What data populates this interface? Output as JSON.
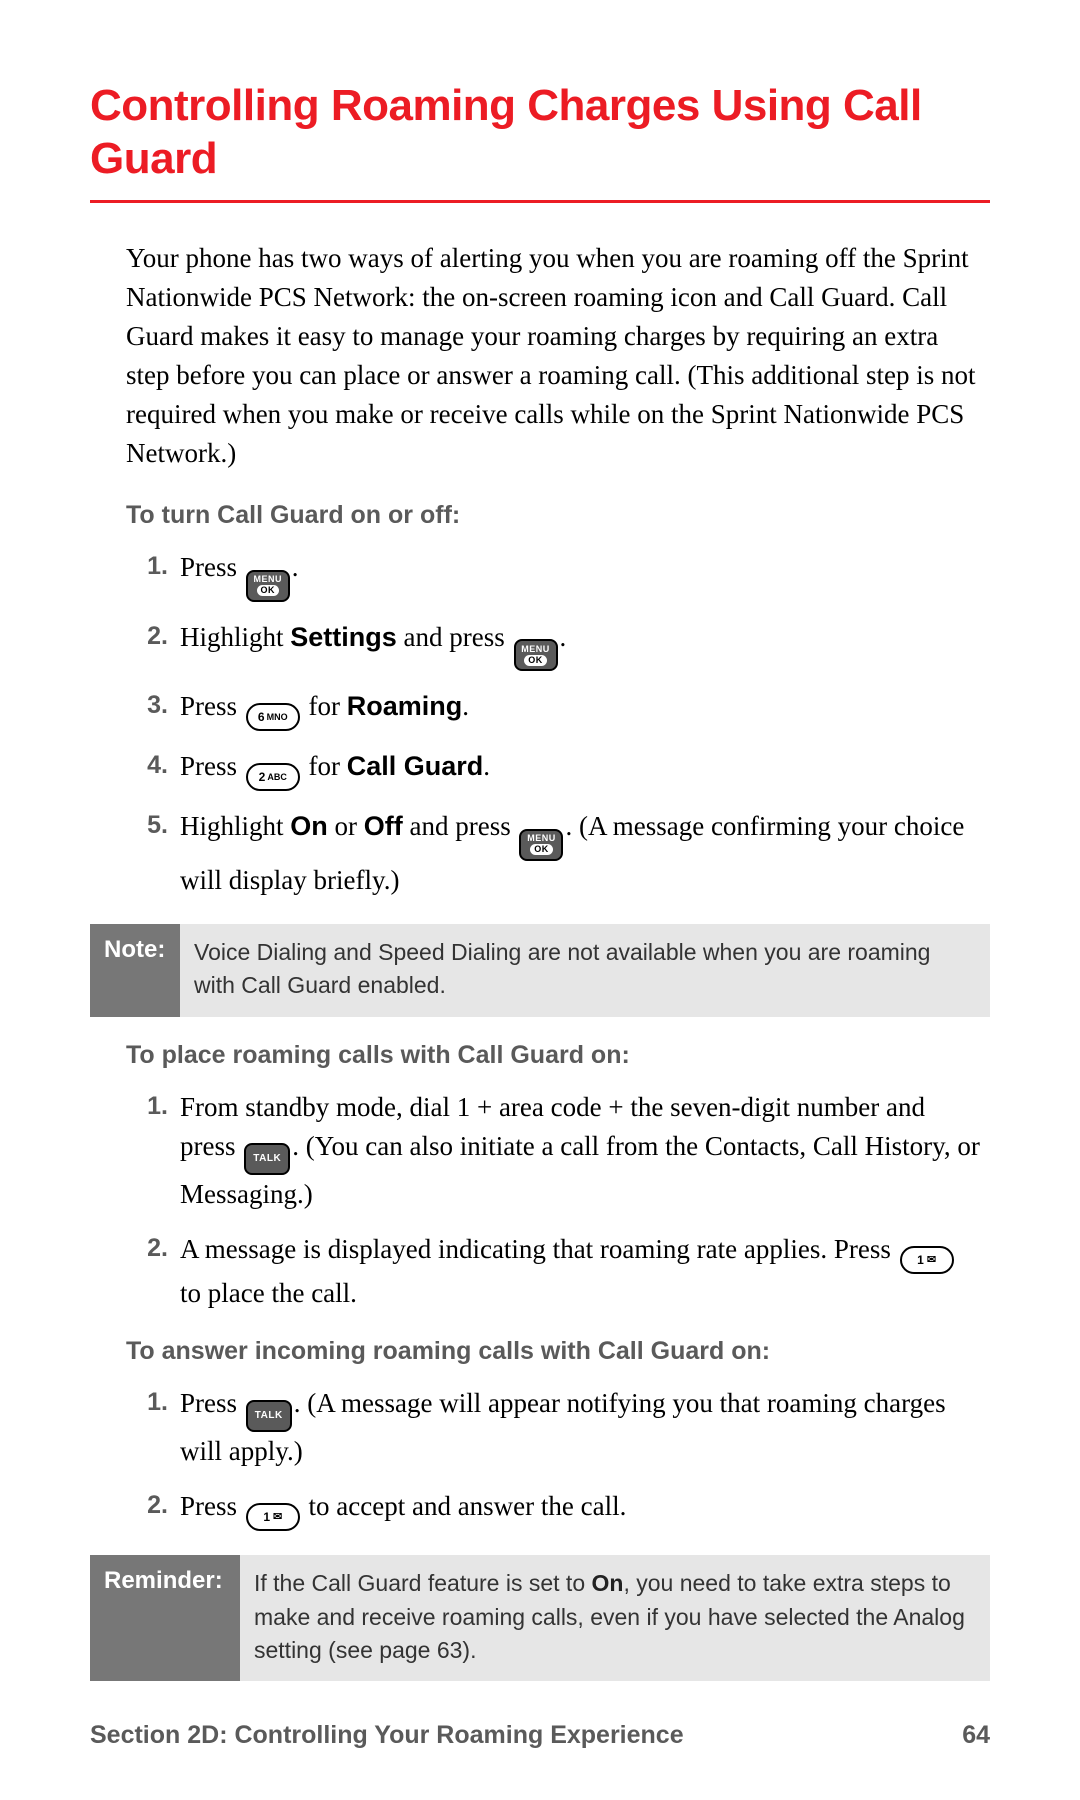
{
  "title": "Controlling Roaming Charges Using Call Guard",
  "intro": "Your phone has two ways of alerting you when you are roaming off the Sprint Nationwide PCS Network: the on-screen roaming icon and Call Guard. Call Guard makes it easy to manage your roaming charges by requiring an extra step before you can place or answer a roaming call. (This additional step is not required when you make or receive calls while on the Sprint Nationwide PCS Network.)",
  "subhead1": "To turn Call Guard on or off:",
  "steps1": [
    {
      "pre": "Press ",
      "key": "menuok",
      "post": "."
    },
    {
      "pre": "Highlight ",
      "bold": "Settings",
      "mid": " and press ",
      "key": "menuok",
      "post": "."
    },
    {
      "pre": "Press ",
      "key": "6",
      "mid": " for ",
      "bold": "Roaming",
      "post": "."
    },
    {
      "pre": "Press ",
      "key": "2",
      "mid": " for ",
      "bold": "Call Guard",
      "post": "."
    },
    {
      "pre": "Highlight ",
      "bold": "On",
      "mid": " or ",
      "bold2": "Off",
      "mid2": " and press ",
      "key": "menuok",
      "post": ". (A message confirming your choice will display briefly.)"
    }
  ],
  "note": {
    "label": "Note:",
    "body": "Voice Dialing and Speed Dialing are not available when you are roaming with Call Guard enabled."
  },
  "subhead2": "To place roaming calls with Call Guard on:",
  "steps2": [
    {
      "pre": "From standby mode, dial 1 + area code + the seven-digit number and press ",
      "key": "talk",
      "post": ". (You can also initiate a call from the Contacts, Call History, or Messaging.)"
    },
    {
      "pre": "A message is displayed indicating that roaming rate applies. Press ",
      "key": "1",
      "post": " to place the call."
    }
  ],
  "subhead3": "To answer incoming roaming calls with Call Guard on:",
  "steps3": [
    {
      "pre": "Press ",
      "key": "talk",
      "post": ". (A message will appear notifying you that roaming charges will apply.)"
    },
    {
      "pre": "Press ",
      "key": "1",
      "post": " to accept and answer the call."
    }
  ],
  "reminder": {
    "label": "Reminder:",
    "body_pre": "If the Call Guard feature is set to ",
    "body_bold": "On",
    "body_post": ", you need to take extra steps to make and receive roaming calls, even if you have selected the Analog setting (see page 63)."
  },
  "footer": {
    "section": "Section 2D: Controlling Your Roaming Experience",
    "page": "64"
  },
  "keys": {
    "menu_label": "MENU",
    "ok_label": "OK",
    "talk_label": "TALK",
    "k1": "1",
    "k2": "2",
    "k2sub": "ABC",
    "k6": "6",
    "k6sub": "MNO"
  }
}
